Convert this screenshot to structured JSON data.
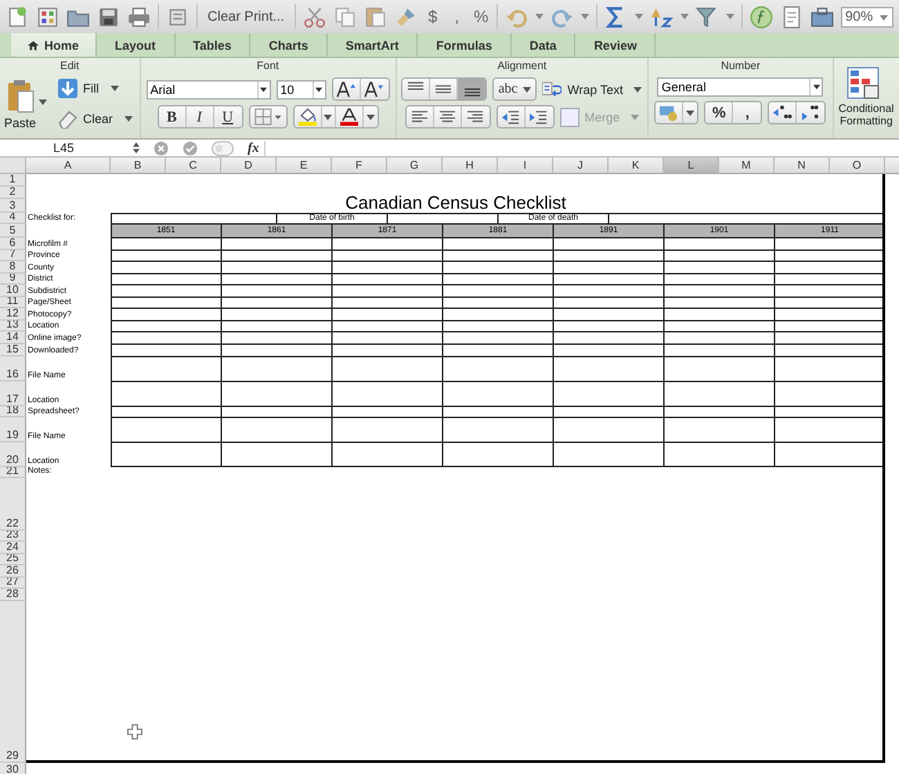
{
  "toolbar": {
    "clear_print": "Clear Print...",
    "symbols": [
      "$",
      ",",
      "%"
    ],
    "zoom": "90%"
  },
  "tabs": [
    {
      "label": "Home",
      "selected": true
    },
    {
      "label": "Layout",
      "selected": false
    },
    {
      "label": "Tables",
      "selected": false
    },
    {
      "label": "Charts",
      "selected": false
    },
    {
      "label": "SmartArt",
      "selected": false
    },
    {
      "label": "Formulas",
      "selected": false
    },
    {
      "label": "Data",
      "selected": false
    },
    {
      "label": "Review",
      "selected": false
    }
  ],
  "ribbon": {
    "edit": {
      "title": "Edit",
      "paste": "Paste",
      "fill": "Fill",
      "clear": "Clear"
    },
    "font": {
      "title": "Font",
      "name": "Arial",
      "size": "10",
      "styles": [
        "B",
        "I",
        "U"
      ]
    },
    "alignment": {
      "title": "Alignment",
      "orientation": "abc",
      "wrap_text": "Wrap Text",
      "merge": {
        "label": "Merge",
        "disabled": true
      }
    },
    "number": {
      "title": "Number",
      "format": "General",
      "symbols": [
        "%",
        ","
      ]
    },
    "conditional_formatting": "Conditional Formatting"
  },
  "formula_bar": {
    "name_box": "L45",
    "fx": "fx"
  },
  "sheet": {
    "columns": [
      {
        "label": "A",
        "selected": false
      },
      {
        "label": "B",
        "selected": false
      },
      {
        "label": "C",
        "selected": false
      },
      {
        "label": "D",
        "selected": false
      },
      {
        "label": "E",
        "selected": false
      },
      {
        "label": "F",
        "selected": false
      },
      {
        "label": "G",
        "selected": false
      },
      {
        "label": "H",
        "selected": false
      },
      {
        "label": "I",
        "selected": false
      },
      {
        "label": "J",
        "selected": false
      },
      {
        "label": "K",
        "selected": false
      },
      {
        "label": "L",
        "selected": true
      },
      {
        "label": "M",
        "selected": false
      },
      {
        "label": "N",
        "selected": false
      },
      {
        "label": "O",
        "selected": false
      }
    ],
    "row_numbers": [
      "1",
      "2",
      "3",
      "4",
      "5",
      "6",
      "7",
      "8",
      "9",
      "10",
      "11",
      "12",
      "13",
      "14",
      "15",
      "16",
      "17",
      "18",
      "19",
      "20",
      "21",
      "22",
      "23",
      "24",
      "25",
      "26",
      "27",
      "28",
      "29",
      "30"
    ],
    "title": "Canadian Census Checklist",
    "checklist_for": "Checklist for:",
    "date_of_birth": "Date of birth",
    "date_of_death": "Date of death",
    "years": [
      "1851",
      "1861",
      "1871",
      "1881",
      "1891",
      "1901",
      "1911"
    ],
    "entries": [
      "Microfilm #",
      "Province",
      "County",
      "District",
      "Subdistrict",
      "Page/Sheet",
      "Photocopy?",
      "Location",
      "Online image?",
      "Downloaded?",
      "File Name",
      "Location",
      "Spreadsheet?",
      "File Name",
      "Location"
    ],
    "notes": "Notes:"
  }
}
